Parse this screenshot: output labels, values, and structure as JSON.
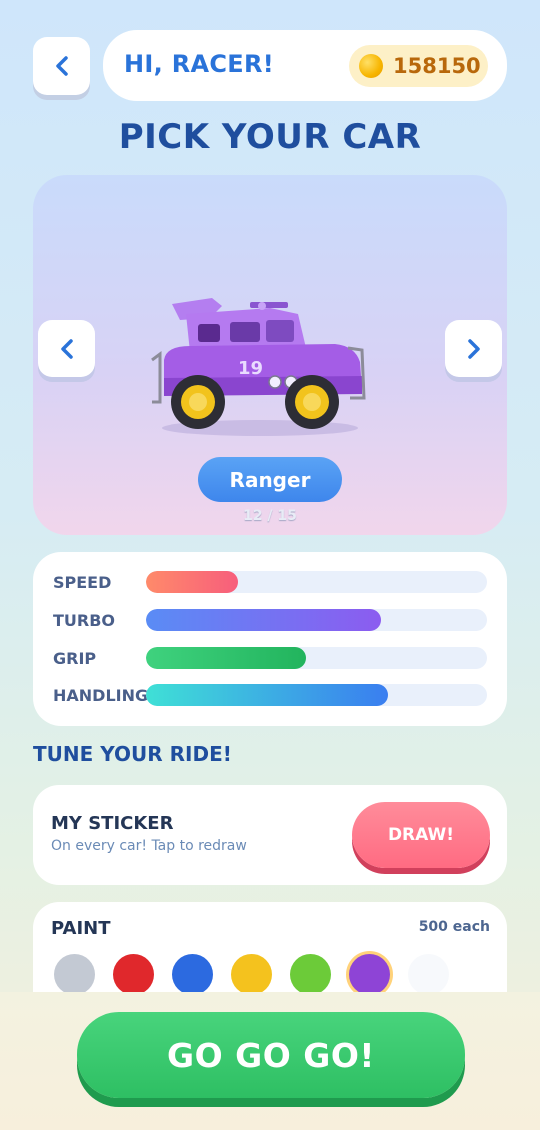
{
  "header": {
    "greeting": "HI, RACER!",
    "coins": "158150"
  },
  "title": "PICK YOUR CAR",
  "car": {
    "name": "Ranger",
    "number": "19",
    "counter": "12 / 15",
    "body_color": "#a45de6"
  },
  "stats": [
    {
      "label": "SPEED",
      "value": 0.27,
      "gradient": [
        "#ff8a6a",
        "#f75e7c"
      ]
    },
    {
      "label": "TURBO",
      "value": 0.69,
      "gradient": [
        "#5a8cf5",
        "#8c5cf0"
      ]
    },
    {
      "label": "GRIP",
      "value": 0.47,
      "gradient": [
        "#3fd27e",
        "#22b45d"
      ]
    },
    {
      "label": "HANDLING",
      "value": 0.71,
      "gradient": [
        "#3fe0d6",
        "#3a7ef0"
      ]
    }
  ],
  "section_title": "TUNE YOUR RIDE!",
  "sticker": {
    "title": "MY STICKER",
    "subtitle": "On every car! Tap to redraw",
    "button": "DRAW!"
  },
  "paint": {
    "title": "PAINT",
    "price": "500 each",
    "swatches": [
      {
        "name": "gray",
        "color": "#c3c9d3",
        "selected": false
      },
      {
        "name": "red",
        "color": "#e0282c",
        "selected": false
      },
      {
        "name": "blue",
        "color": "#2c6ae0",
        "selected": false
      },
      {
        "name": "yellow",
        "color": "#f4c21e",
        "selected": false
      },
      {
        "name": "green",
        "color": "#6ccb39",
        "selected": false
      },
      {
        "name": "purple",
        "color": "#8e44d6",
        "selected": true
      },
      {
        "name": "white",
        "color": "#f7f9fc",
        "selected": false
      }
    ]
  },
  "go_button": "GO GO GO!"
}
